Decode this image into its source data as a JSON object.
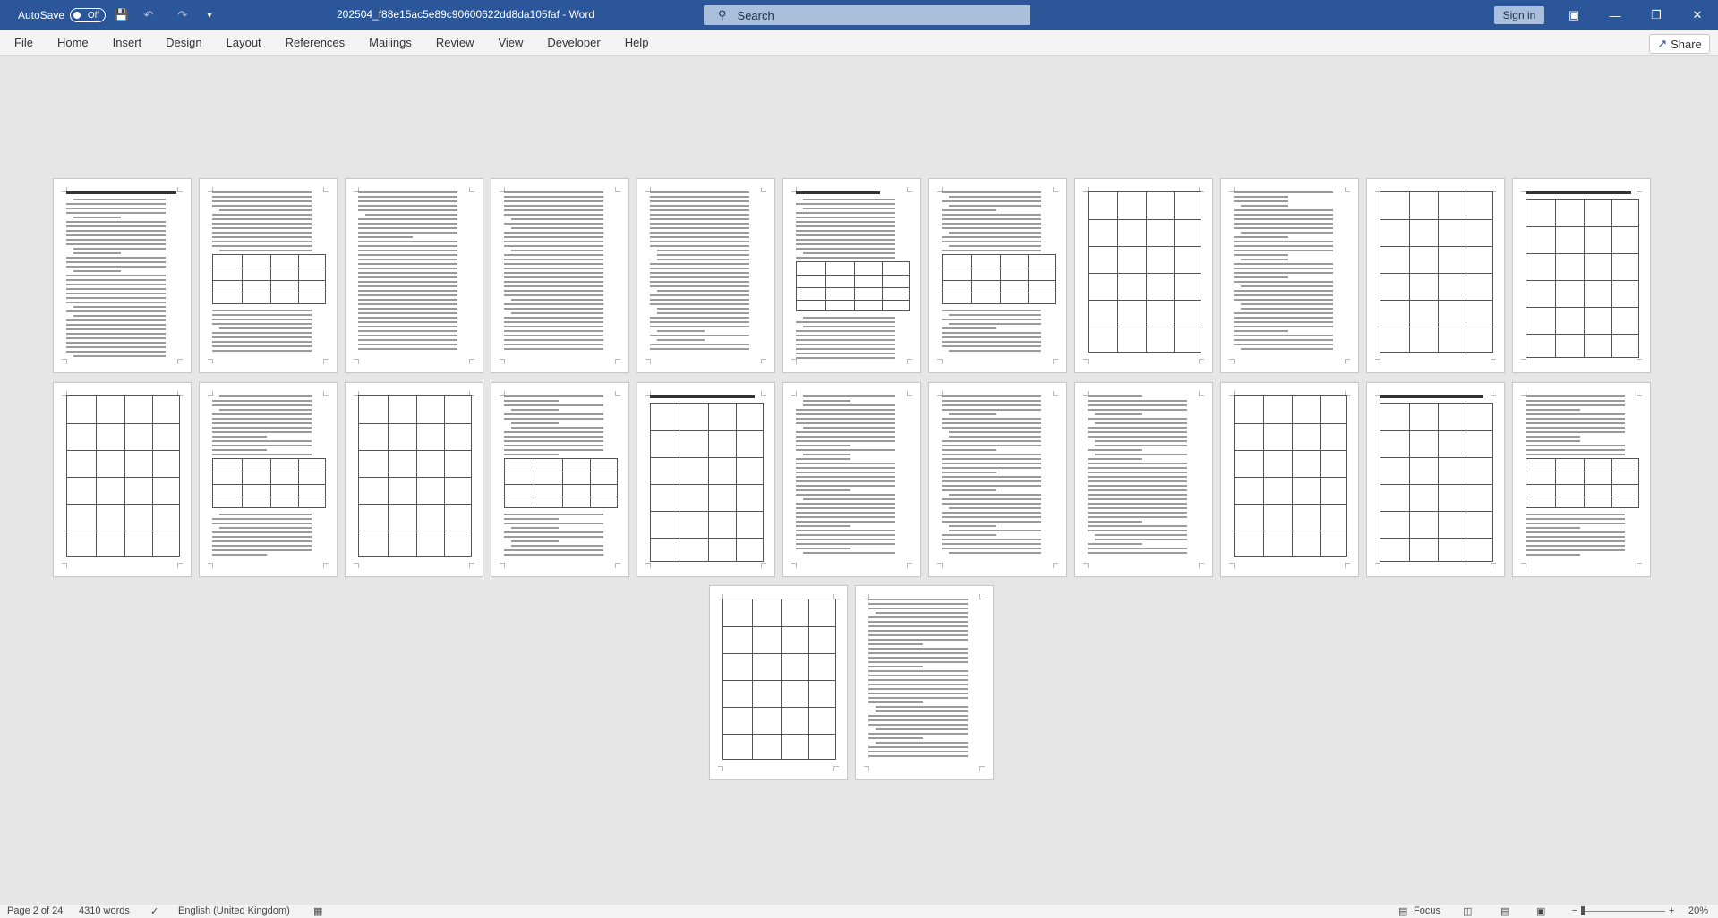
{
  "titlebar": {
    "autosave_label": "AutoSave",
    "autosave_state": "Off",
    "document_title": "202504_f88e15ac5e89c90600622dd8da105faf  -  Word",
    "search_placeholder": "Search",
    "signin_label": "Sign in",
    "save_icon": "save-icon",
    "undo_icon": "undo-icon",
    "redo_icon": "redo-icon",
    "customize_icon": "customize-quick-access-icon"
  },
  "ribbon": {
    "tabs": [
      "File",
      "Home",
      "Insert",
      "Design",
      "Layout",
      "References",
      "Mailings",
      "Review",
      "View",
      "Developer",
      "Help"
    ],
    "share_label": "Share"
  },
  "status": {
    "page": "Page 2 of 24",
    "words": "4310 words",
    "language": "English (United Kingdom)",
    "focus": "Focus",
    "zoom": "20%"
  },
  "colors": {
    "title_bar": "#2b579a",
    "ribbon_bg": "#f3f3f3",
    "canvas_bg": "#e6e6e6"
  }
}
